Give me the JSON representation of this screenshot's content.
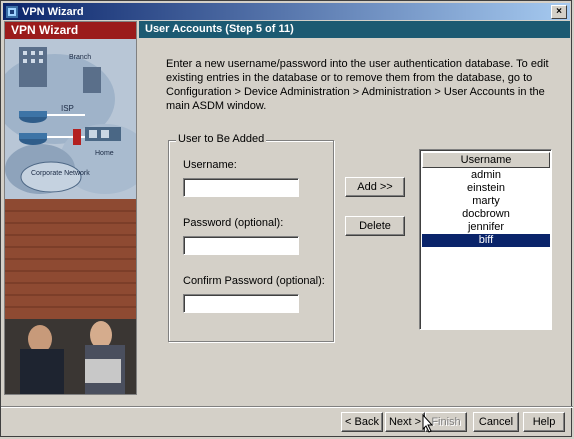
{
  "window": {
    "title": "VPN Wizard",
    "close_symbol": "×"
  },
  "sidebar": {
    "header": "VPN Wizard",
    "diagram_labels": {
      "branch": "Branch",
      "isp": "ISP",
      "home": "Home",
      "corporate_network": "Corporate\nNetwork"
    }
  },
  "step_header": "User Accounts   (Step 5 of 11)",
  "intro_text": "Enter a new username/password into the user authentication database.  To edit existing entries in the database or to remove them from the database, go to Configuration > Device Administration > Administration > User Accounts in the main ASDM window.",
  "form": {
    "group_title": "User to Be Added",
    "username_label": "Username:",
    "username_value": "",
    "password_label": "Password (optional):",
    "password_value": "",
    "confirm_label": "Confirm Password (optional):",
    "confirm_value": ""
  },
  "actions": {
    "add_label": "Add >>",
    "delete_label": "Delete"
  },
  "user_list": {
    "header": "Username",
    "items": [
      "admin",
      "einstein",
      "marty",
      "docbrown",
      "jennifer",
      "biff"
    ],
    "selected_index": 5
  },
  "footer": {
    "back_label": "< Back",
    "next_label": "Next >",
    "finish_label": "Finish",
    "cancel_label": "Cancel",
    "help_label": "Help"
  },
  "colors": {
    "title_bar_start": "#0a246a",
    "sidebar_header": "#9b1b1b",
    "step_header": "#1c5a72",
    "selection": "#0a246a"
  }
}
